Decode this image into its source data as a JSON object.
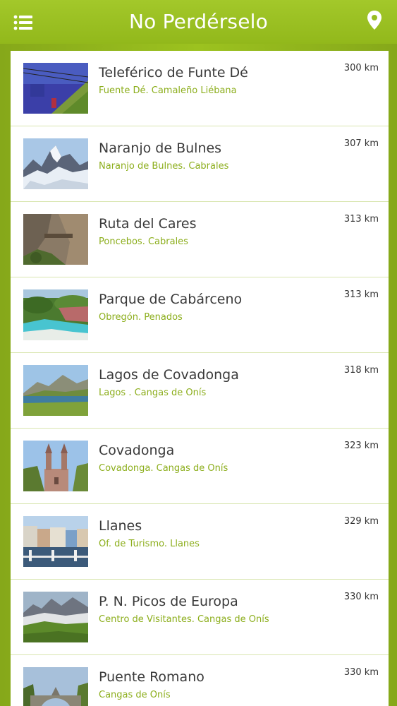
{
  "header": {
    "title": "No Perdérselo",
    "menu_icon": "hamburger-menu-icon",
    "location_icon": "map-pin-icon"
  },
  "colors": {
    "accent": "#94b91e",
    "location_text": "#8cae1c",
    "card": "#ffffff"
  },
  "places": [
    {
      "name": "Teleférico de Funte Dé",
      "location": "Fuente Dé. Camaleño Liébana",
      "distance": "300 km"
    },
    {
      "name": "Naranjo de Bulnes",
      "location": "Naranjo de Bulnes. Cabrales",
      "distance": "307 km"
    },
    {
      "name": "Ruta del Cares",
      "location": "Poncebos. Cabrales",
      "distance": "313 km"
    },
    {
      "name": "Parque de Cabárceno",
      "location": "Obregón. Penados",
      "distance": "313 km"
    },
    {
      "name": "Lagos de Covadonga",
      "location": "Lagos . Cangas de Onís",
      "distance": "318 km"
    },
    {
      "name": "Covadonga",
      "location": "Covadonga. Cangas de Onís",
      "distance": "323 km"
    },
    {
      "name": "Llanes",
      "location": "Of. de Turismo. Llanes",
      "distance": "329 km"
    },
    {
      "name": "P. N. Picos de Europa",
      "location": "Centro de Visitantes. Cangas de Onís",
      "distance": "330 km"
    },
    {
      "name": "Puente Romano",
      "location": "Cangas de Onís",
      "distance": "330 km"
    }
  ]
}
